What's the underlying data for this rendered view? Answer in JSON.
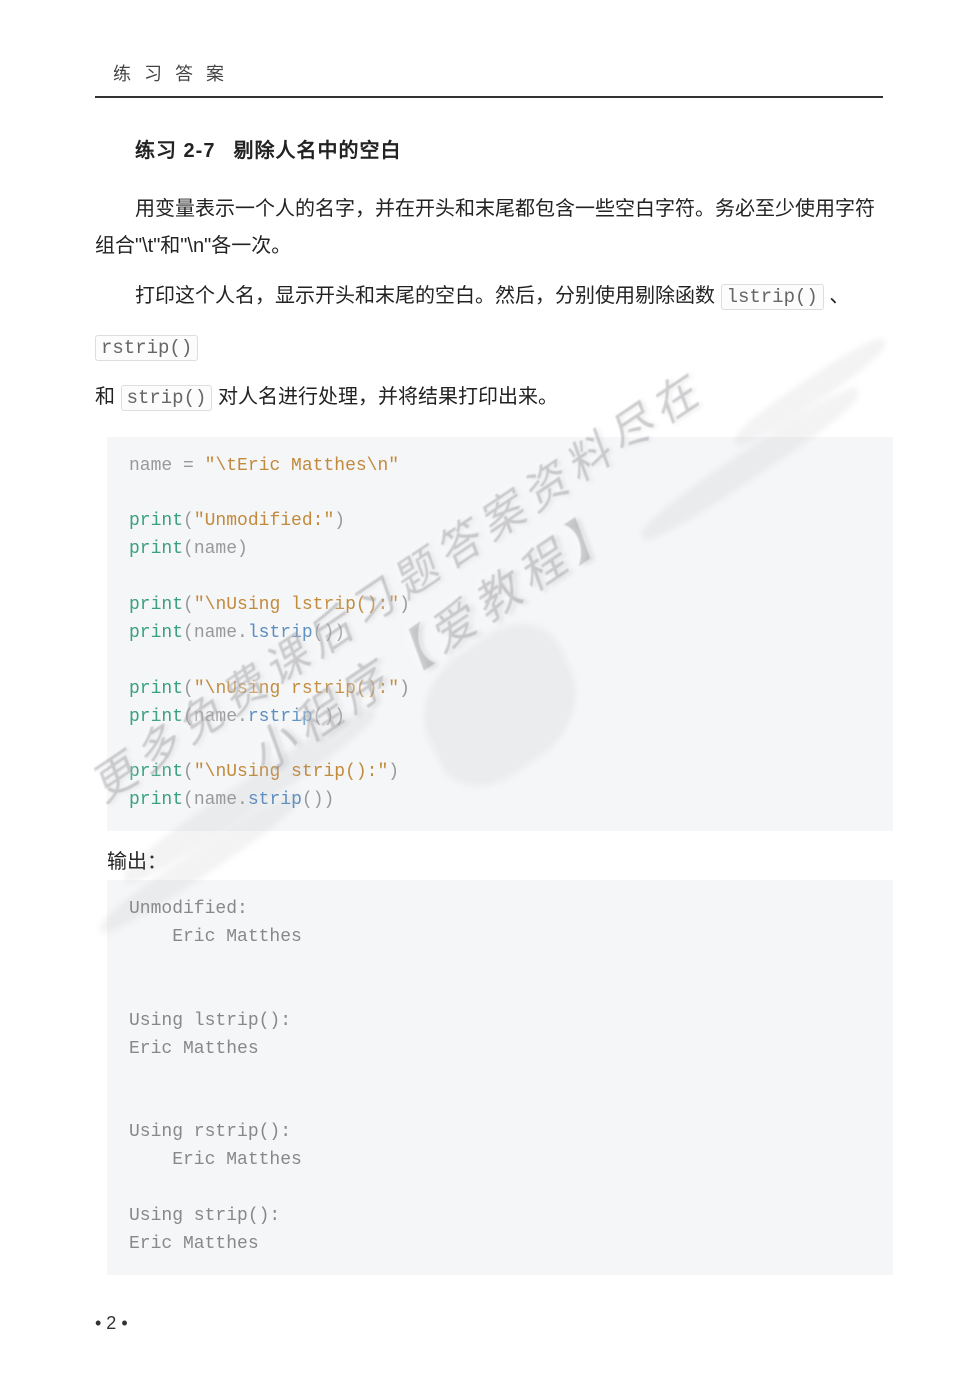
{
  "header": "练 习 答 案",
  "exercise": {
    "number": "练习 2-7",
    "title": "剔除人名中的空白"
  },
  "paragraphs": {
    "p1": "用变量表示一个人的名字，并在开头和末尾都包含一些空白字符。务必至少使用字符组合\"\\t\"和\"\\n\"各一次。",
    "p2a": "打印这个人名，显示开头和末尾的空白。然后，分别使用剔除函数 ",
    "p2b": " 、",
    "p2c": "和 ",
    "p2d": " 对人名进行处理，并将结果打印出来。"
  },
  "inline_codes": {
    "lstrip": "lstrip()",
    "rstrip": "rstrip()",
    "strip": "strip()"
  },
  "code": {
    "l1_name": "name",
    "l1_eq": " = ",
    "l1_q1": "\"",
    "l1_esc1": "\\t",
    "l1_str": "Eric Matthes",
    "l1_esc2": "\\n",
    "l1_q2": "\"",
    "print": "print",
    "lp": "(",
    "rp": ")",
    "dot": ".",
    "s_unmod": "\"Unmodified:\"",
    "s_lstrip_q1": "\"",
    "s_lstrip_esc": "\\n",
    "s_lstrip_txt": "Using lstrip():",
    "s_lstrip_q2": "\"",
    "s_rstrip_txt": "Using rstrip():",
    "s_strip_txt": "Using strip():",
    "fn_lstrip": "lstrip",
    "fn_rstrip": "rstrip",
    "fn_strip": "strip"
  },
  "output_label": "输出：",
  "output": "Unmodified:\n    Eric Matthes\n\n\nUsing lstrip():\nEric Matthes\n\n\nUsing rstrip():\n    Eric Matthes\n\nUsing strip():\nEric Matthes",
  "page_number": "• 2 •",
  "watermark": {
    "line1": "更多免费课后习题答案资料尽在",
    "line2": "小程序【爱教程】"
  }
}
